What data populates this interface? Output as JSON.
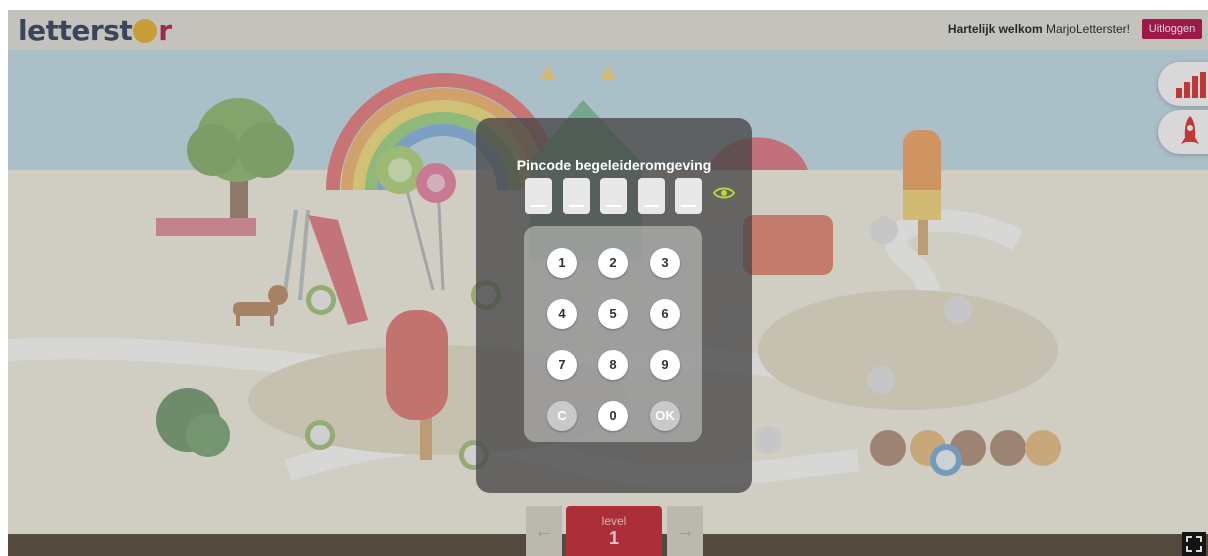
{
  "header": {
    "logo_text": "letterstar",
    "welcome_bold": "Hartelijk welkom",
    "username": "MarjoLetterster!",
    "logout_label": "Uitloggen"
  },
  "side_buttons": [
    {
      "name": "stats",
      "icon": "bar-chart-icon"
    },
    {
      "name": "rocket",
      "icon": "rocket-icon"
    }
  ],
  "pin_modal": {
    "title": "Pincode begeleideromgeving",
    "digits_count": 5,
    "eye_icon": "eye-icon",
    "keys": [
      "1",
      "2",
      "3",
      "4",
      "5",
      "6",
      "7",
      "8",
      "9",
      "C",
      "0",
      "OK"
    ]
  },
  "level_nav": {
    "prev_icon": "arrow-left-icon",
    "label": "level",
    "number": "1",
    "next_icon": "arrow-right-icon"
  },
  "fullscreen_icon": "fullscreen-icon",
  "colors": {
    "logout_bg": "#b71650",
    "accent_red": "#c9303c",
    "eye_green": "#b8d63a",
    "sand": "#f1ead3",
    "sky": "#a9cfe0"
  }
}
